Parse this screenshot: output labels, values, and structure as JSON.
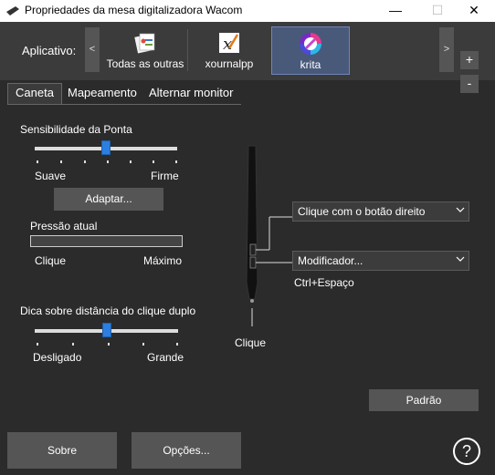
{
  "window": {
    "title": "Propriedades da mesa digitalizadora Wacom"
  },
  "apps": {
    "label": "Aplicativo:",
    "prev": "<",
    "next": ">",
    "items": [
      {
        "label": "Todas as outras",
        "icon": "all-apps-icon"
      },
      {
        "label": "xournalpp",
        "icon": "xournalpp-icon"
      },
      {
        "label": "krita",
        "icon": "krita-icon",
        "selected": true
      }
    ],
    "add": "+",
    "remove": "-"
  },
  "tabs": [
    "Caneta",
    "Mapeamento",
    "Alternar monitor"
  ],
  "tip": {
    "label": "Sensibilidade da Ponta",
    "min_label": "Suave",
    "max_label": "Firme",
    "value_fraction": 0.5,
    "adapt_button": "Adaptar..."
  },
  "pressure": {
    "label": "Pressão atual",
    "left_label": "Clique",
    "right_label": "Máximo",
    "value_fraction": 0.0
  },
  "double_click": {
    "label": "Dica sobre distância do clique duplo",
    "min_label": "Desligado",
    "max_label": "Grande",
    "value_fraction": 0.5
  },
  "pen": {
    "upper_button": "Clique com o botão direito",
    "lower_button": "Modificador...",
    "lower_sub": "Ctrl+Espaço",
    "tip_action": "Clique"
  },
  "default_button": "Padrão",
  "footer": {
    "about": "Sobre",
    "options": "Opções...",
    "help": "?"
  },
  "colors": {
    "accent": "#2b7fe0",
    "selected_tile": "#49597a"
  }
}
